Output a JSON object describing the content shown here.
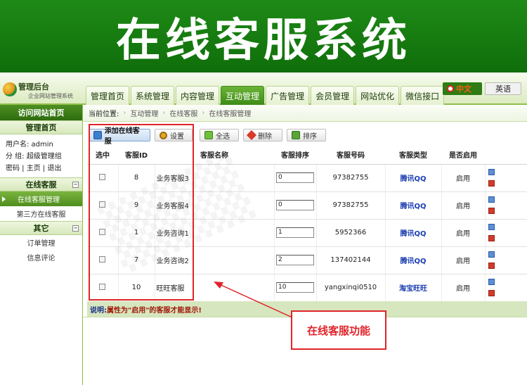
{
  "banner": {
    "title": "在线客服系统"
  },
  "brand": {
    "title": "管理后台",
    "subtitle": "企业网站管理系统"
  },
  "nav": {
    "tabs": [
      {
        "label": "管理首页"
      },
      {
        "label": "系统管理"
      },
      {
        "label": "内容管理"
      },
      {
        "label": "互动管理",
        "active": true
      },
      {
        "label": "广告管理"
      },
      {
        "label": "会员管理"
      },
      {
        "label": "网站优化"
      },
      {
        "label": "微信接口"
      }
    ],
    "lang_cn": "中文",
    "lang_en": "英语"
  },
  "sidebar": {
    "home_link": "访问网站首页",
    "section_home": "管理首页",
    "user_line": "用户名: admin",
    "group_line": "分  组: 超级管理组",
    "links_line": "密码 | 主页 | 退出",
    "section_service": "在线客服",
    "service_items": [
      {
        "label": "在线客服管理",
        "active": true
      },
      {
        "label": "第三方在线客服"
      }
    ],
    "section_other": "其它",
    "other_items": [
      {
        "label": "订单管理"
      },
      {
        "label": "信息评论"
      }
    ],
    "toggle_symbol": "−"
  },
  "breadcrumb": {
    "label": "当前位置:",
    "items": [
      "互动管理",
      "在线客服",
      "在线客服管理"
    ]
  },
  "toolbar": {
    "add": "添加在线客服",
    "settings": "设置",
    "select_all": "全选",
    "delete": "删除",
    "sort": "排序",
    "tooltip": "设置"
  },
  "table": {
    "headers": [
      "选中",
      "客服ID",
      "客服名称",
      "客服排序",
      "客服号码",
      "客服类型",
      "是否启用"
    ],
    "rows": [
      {
        "id": "8",
        "name": "业务客服3",
        "sort": "0",
        "number": "97382755",
        "type": "腾讯QQ",
        "enabled": "启用"
      },
      {
        "id": "9",
        "name": "业务客服4",
        "sort": "0",
        "number": "97382755",
        "type": "腾讯QQ",
        "enabled": "启用"
      },
      {
        "id": "1",
        "name": "业务咨询1",
        "sort": "1",
        "number": "5952366",
        "type": "腾讯QQ",
        "enabled": "启用"
      },
      {
        "id": "7",
        "name": "业务咨询2",
        "sort": "2",
        "number": "137402144",
        "type": "腾讯QQ",
        "enabled": "启用"
      },
      {
        "id": "10",
        "name": "旺旺客服",
        "sort": "10",
        "number": "yangxinqi0510",
        "type": "淘宝旺旺",
        "enabled": "启用"
      }
    ]
  },
  "note": {
    "prefix": "说明:",
    "text": "属性为\"启用\"的客服才能显示!"
  },
  "annotation": {
    "callout": "在线客服功能",
    "color": "#e0242a"
  }
}
